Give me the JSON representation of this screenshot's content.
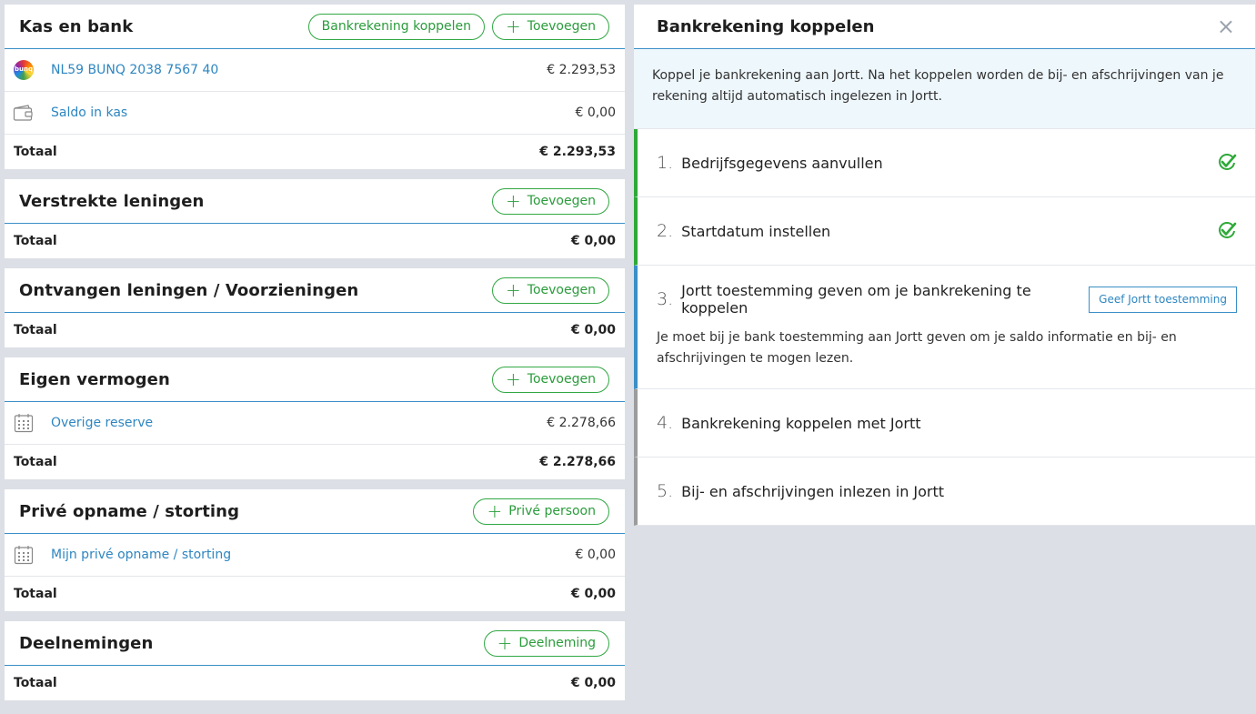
{
  "left": {
    "cards": [
      {
        "title": "Kas en bank",
        "buttons": [
          "Bankrekening koppelen",
          "+ Toevoegen"
        ],
        "rows": [
          {
            "icon": "bunq-logo-icon",
            "label": "NL59 BUNQ 2038 7567 40",
            "amount": "€ 2.293,53"
          },
          {
            "icon": "wallet-icon",
            "label": "Saldo in kas",
            "amount": "€ 0,00"
          }
        ],
        "total_label": "Totaal",
        "total_amount": "€ 2.293,53"
      },
      {
        "title": "Verstrekte leningen",
        "buttons": [
          "Toevoegen"
        ],
        "rows": [],
        "total_label": "Totaal",
        "total_amount": "€ 0,00"
      },
      {
        "title": "Ontvangen leningen / Voorzieningen",
        "buttons": [
          "Toevoegen"
        ],
        "rows": [],
        "total_label": "Totaal",
        "total_amount": "€ 0,00"
      },
      {
        "title": "Eigen vermogen",
        "buttons": [
          "Toevoegen"
        ],
        "rows": [
          {
            "icon": "calendar-icon",
            "label": "Overige reserve",
            "amount": "€ 2.278,66"
          }
        ],
        "total_label": "Totaal",
        "total_amount": "€ 2.278,66"
      },
      {
        "title": "Privé opname / storting",
        "buttons": [
          "Privé persoon"
        ],
        "rows": [
          {
            "icon": "calendar-icon",
            "label": "Mijn privé opname / storting",
            "amount": "€ 0,00"
          }
        ],
        "total_label": "Totaal",
        "total_amount": "€ 0,00"
      },
      {
        "title": "Deelnemingen",
        "buttons": [
          "Deelneming"
        ],
        "rows": [],
        "total_label": "Totaal",
        "total_amount": "€ 0,00"
      }
    ]
  },
  "panel": {
    "title": "Bankrekening koppelen",
    "intro": "Koppel je bankrekening aan Jortt. Na het koppelen worden de bij- en afschrijvingen van je rekening altijd automatisch ingelezen in Jortt.",
    "steps": [
      {
        "num": "1.",
        "label": "Bedrijfsgegevens aanvullen",
        "status": "done"
      },
      {
        "num": "2.",
        "label": "Startdatum instellen",
        "status": "done"
      },
      {
        "num": "3.",
        "label": "Jortt toestemming geven om je bankrekening te koppelen",
        "status": "active",
        "button": "Geef Jortt toestemming",
        "desc": "Je moet bij je bank toestemming aan Jortt geven om je saldo informatie en bij- en afschrijvingen te mogen lezen."
      },
      {
        "num": "4.",
        "label": "Bankrekening koppelen met Jortt",
        "status": "todo"
      },
      {
        "num": "5.",
        "label": "Bij- en afschrijvingen inlezen in Jortt",
        "status": "todo"
      }
    ]
  },
  "colors": {
    "accent_green": "#2a9c3b",
    "link_blue": "#2e86c1",
    "divider_blue": "#3a8fc7"
  }
}
